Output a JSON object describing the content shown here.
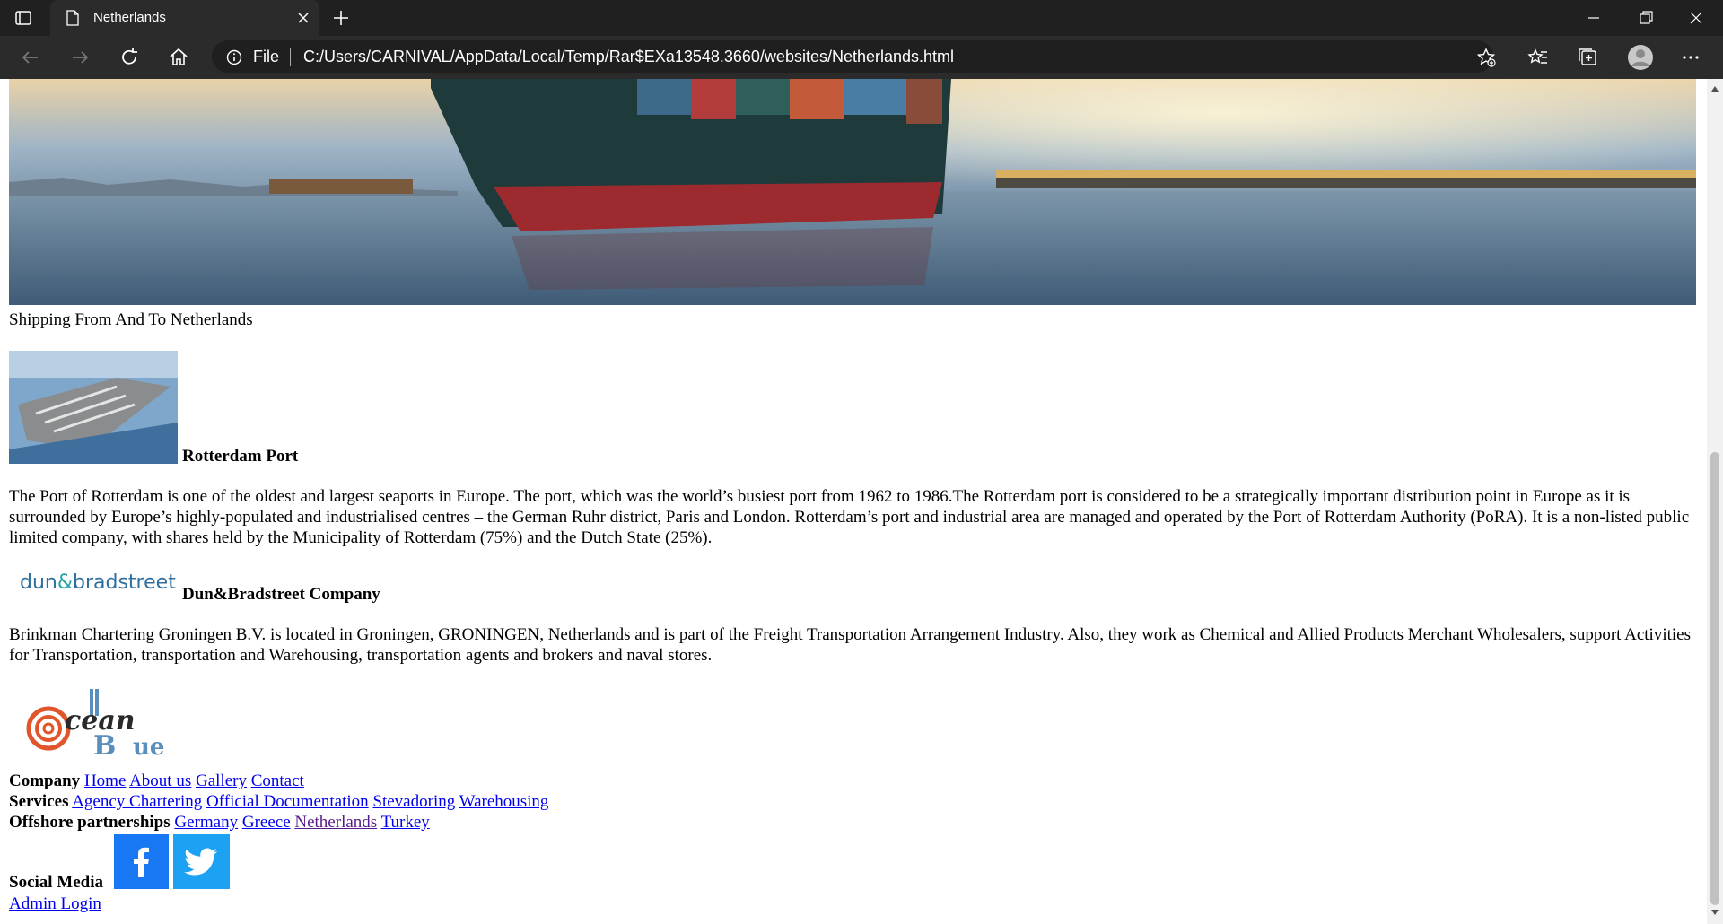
{
  "browser": {
    "tab_title": "Netherlands",
    "url_scheme": "File",
    "url": "C:/Users/CARNIVAL/AppData/Local/Temp/Rar$EXa13548.3660/websites/Netherlands.html"
  },
  "page": {
    "caption": "Shipping From And To Netherlands",
    "sections": [
      {
        "heading": "Rotterdam Port",
        "text": "The Port of Rotterdam is one of the oldest and largest seaports in Europe. The port, which was the world’s busiest port from 1962 to 1986.The Rotterdam port is considered to be a strategically important distribution point in Europe as it is surrounded by Europe’s highly-populated and industrialised centres – the German Ruhr district, Paris and London. Rotterdam’s port and industrial area are managed and operated by the Port of Rotterdam Authority (PoRA). It is a non-listed public limited company, with shares held by the Municipality of Rotterdam (75%) and the Dutch State (25%)."
      },
      {
        "heading": "Dun&Bradstreet Company",
        "logo_text_a": "dun",
        "logo_text_amp": "&",
        "logo_text_b": "bradstreet",
        "text": "Brinkman Chartering Groningen B.V. is located in Groningen, GRONINGEN, Netherlands and is part of the Freight Transportation Arrangement Industry. Also, they work as Chemical and Allied Products Merchant Wholesalers, support Activities for Transportation, transportation and Warehousing, transportation agents and brokers and naval stores."
      }
    ],
    "footer_logo": {
      "line1": "cean",
      "line2": "ue"
    },
    "footer": {
      "company_label": "Company",
      "company_links": [
        "Home",
        "About us",
        "Gallery",
        "Contact"
      ],
      "services_label": "Services",
      "services_links": [
        "Agency Chartering",
        "Official Documentation",
        "Stevadoring",
        "Warehousing"
      ],
      "offshore_label": "Offshore partnerships",
      "offshore_links": [
        "Germany",
        "Greece",
        "Netherlands",
        "Turkey"
      ],
      "social_label": "Social Media",
      "admin_link": "Admin Login"
    }
  },
  "colors": {
    "chrome_dark": "#202020",
    "link": "#0000ee",
    "link_visited": "#551a8b",
    "facebook": "#1877f2",
    "twitter": "#1da1f2"
  },
  "icons": [
    "tab-actions-icon",
    "page-icon",
    "close-icon",
    "plus-icon",
    "minimize-icon",
    "maximize-icon",
    "back-icon",
    "forward-icon",
    "refresh-icon",
    "home-icon",
    "info-icon",
    "add-favorite-icon",
    "favorites-icon",
    "collections-icon",
    "profile-icon",
    "more-icon",
    "facebook-icon",
    "twitter-icon"
  ]
}
